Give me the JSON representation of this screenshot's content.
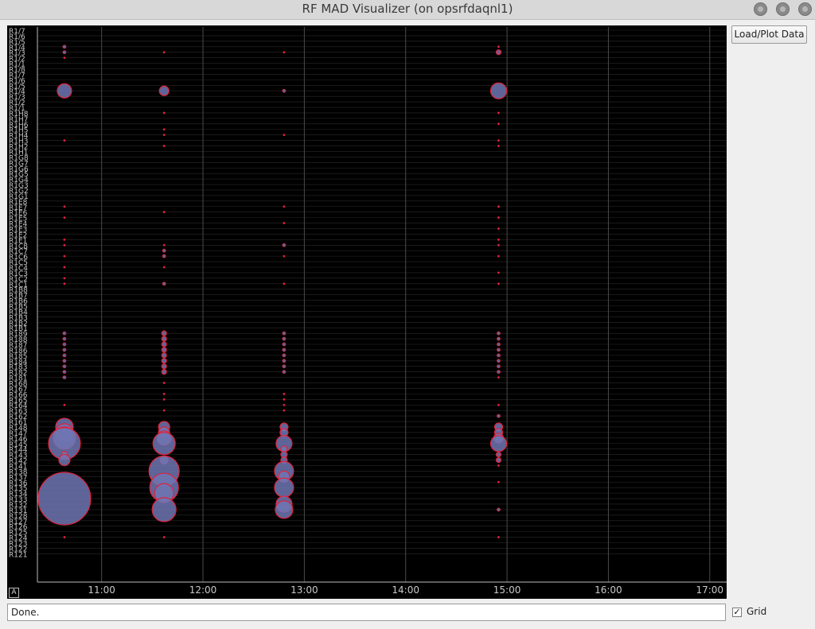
{
  "window": {
    "title": "RF MAD Visualizer (on opsrfdaqnl1)"
  },
  "buttons": {
    "load_plot": "Load/Plot Data"
  },
  "status": {
    "text": "Done."
  },
  "grid_checkbox": {
    "label": "Grid",
    "checked": true,
    "mark": "✓"
  },
  "plot": {
    "axis_badge": "A",
    "colors": {
      "background": "#000000",
      "bubble_fill": "#6f76b3",
      "bubble_stroke": "#e0233b",
      "label": "#c8c8c8"
    },
    "x_ticks": [
      "11:00",
      "12:00",
      "13:00",
      "14:00",
      "15:00",
      "16:00",
      "17:00"
    ],
    "y_labels": [
      "R1/7",
      "R1/6",
      "R1/5",
      "R1/4",
      "R1/3",
      "R1/2",
      "R1/1",
      "R1/8",
      "R1/7",
      "R1/6",
      "R1/5",
      "R1/4",
      "R1/3",
      "R1/2",
      "R1/1",
      "R1H8",
      "R1H7",
      "R1H6",
      "R1H5",
      "R1H4",
      "R1H3",
      "R1H2",
      "R1H1",
      "R1G8",
      "R1G7",
      "R1G6",
      "R1G5",
      "R1G4",
      "R1G3",
      "R1G2",
      "R1G1",
      "R1E8",
      "R1E7",
      "R1E6",
      "R1E5",
      "R1E4",
      "R1E3",
      "R1E2",
      "R1E1",
      "R1C8",
      "R1C7",
      "R1C6",
      "R1C5",
      "R1C4",
      "R1C3",
      "R1C2",
      "R1C1",
      "R1B8",
      "R1B7",
      "R1B6",
      "R1B5",
      "R1B4",
      "R1B3",
      "R1B2",
      "R1B1",
      "R189",
      "R188",
      "R187",
      "R186",
      "R185",
      "R184",
      "R183",
      "R182",
      "R181",
      "R168",
      "R167",
      "R166",
      "R165",
      "R164",
      "R163",
      "R162",
      "R161",
      "R148",
      "R147",
      "R146",
      "R145",
      "R144",
      "R143",
      "R142",
      "R141",
      "R138",
      "R137",
      "R136",
      "R135",
      "R134",
      "R133",
      "R132",
      "R131",
      "R128",
      "R127",
      "R126",
      "R125",
      "R124",
      "R123",
      "R122",
      "R121"
    ]
  },
  "chart_data": {
    "type": "scatter",
    "xlabel": "",
    "ylabel": "",
    "xlim": [
      "10:22",
      "17:10"
    ],
    "grid": true,
    "series": [
      {
        "time": "10:38",
        "points": [
          {
            "label": "R1/3",
            "size": 2
          },
          {
            "label": "R1/4",
            "size": 2
          },
          {
            "label": "R1/2",
            "size": 1
          },
          {
            "label": "R1/4",
            "size": 9,
            "index": 11
          },
          {
            "label": "R1H3",
            "size": 1,
            "index": 20
          },
          {
            "label": "R1E7",
            "size": 1,
            "index": 32
          },
          {
            "label": "R1E5",
            "size": 1,
            "index": 34
          },
          {
            "label": "R1E1",
            "size": 1,
            "index": 38
          },
          {
            "label": "R1C8",
            "size": 1,
            "index": 39
          },
          {
            "label": "R1C6",
            "size": 1,
            "index": 41
          },
          {
            "label": "R1C4",
            "size": 1,
            "index": 43
          },
          {
            "label": "R1C2",
            "size": 1,
            "index": 45
          },
          {
            "label": "R1C1",
            "size": 1,
            "index": 46
          },
          {
            "label": "R189",
            "size": 2,
            "index": 55
          },
          {
            "label": "R188",
            "size": 2,
            "index": 56
          },
          {
            "label": "R187",
            "size": 2,
            "index": 57
          },
          {
            "label": "R186",
            "size": 2,
            "index": 58
          },
          {
            "label": "R185",
            "size": 2,
            "index": 59
          },
          {
            "label": "R184",
            "size": 2,
            "index": 60
          },
          {
            "label": "R183",
            "size": 2,
            "index": 61
          },
          {
            "label": "R182",
            "size": 2,
            "index": 62
          },
          {
            "label": "R181",
            "size": 2,
            "index": 63
          },
          {
            "label": "R164",
            "size": 1,
            "index": 68
          },
          {
            "label": "R148",
            "size": 11,
            "index": 72
          },
          {
            "label": "R147",
            "size": 11,
            "index": 73
          },
          {
            "label": "R146",
            "size": 14,
            "index": 74
          },
          {
            "label": "R145",
            "size": 20,
            "index": 75
          },
          {
            "label": "R143",
            "size": 4,
            "index": 77
          },
          {
            "label": "R142",
            "size": 7,
            "index": 78
          },
          {
            "label": "R133",
            "size": 33,
            "index": 85
          },
          {
            "label": "R123",
            "size": 1,
            "index": 92
          }
        ]
      },
      {
        "time": "11:37",
        "points": [
          {
            "label": "R1/3",
            "size": 1,
            "index": 4
          },
          {
            "label": "R1/4",
            "size": 6,
            "index": 11
          },
          {
            "label": "R1H8",
            "size": 1,
            "index": 15
          },
          {
            "label": "R1H5",
            "size": 1,
            "index": 18
          },
          {
            "label": "R1H4",
            "size": 1,
            "index": 19
          },
          {
            "label": "R1H2",
            "size": 1,
            "index": 21
          },
          {
            "label": "R1E6",
            "size": 1,
            "index": 33
          },
          {
            "label": "R1C8",
            "size": 1,
            "index": 39
          },
          {
            "label": "R1C7",
            "size": 2,
            "index": 40
          },
          {
            "label": "R1C6",
            "size": 2,
            "index": 41
          },
          {
            "label": "R1C4",
            "size": 1,
            "index": 43
          },
          {
            "label": "R1C1",
            "size": 2,
            "index": 46
          },
          {
            "label": "R189",
            "size": 3,
            "index": 55
          },
          {
            "label": "R188",
            "size": 3,
            "index": 56
          },
          {
            "label": "R187",
            "size": 3,
            "index": 57
          },
          {
            "label": "R186",
            "size": 3,
            "index": 58
          },
          {
            "label": "R185",
            "size": 3,
            "index": 59
          },
          {
            "label": "R184",
            "size": 3,
            "index": 60
          },
          {
            "label": "R183",
            "size": 3,
            "index": 61
          },
          {
            "label": "R182",
            "size": 3,
            "index": 62
          },
          {
            "label": "R181",
            "size": 1,
            "index": 64
          },
          {
            "label": "R166",
            "size": 1,
            "index": 66
          },
          {
            "label": "R165",
            "size": 1,
            "index": 67
          },
          {
            "label": "R163",
            "size": 1,
            "index": 69
          },
          {
            "label": "R148",
            "size": 7,
            "index": 72
          },
          {
            "label": "R147",
            "size": 7,
            "index": 73
          },
          {
            "label": "R146",
            "size": 9,
            "index": 74
          },
          {
            "label": "R145",
            "size": 14,
            "index": 75
          },
          {
            "label": "R141",
            "size": 5,
            "index": 78
          },
          {
            "label": "R138",
            "size": 19,
            "index": 80
          },
          {
            "label": "R136",
            "size": 18,
            "index": 83
          },
          {
            "label": "R135",
            "size": 12,
            "index": 84
          },
          {
            "label": "R131",
            "size": 15,
            "index": 87
          },
          {
            "label": "R123",
            "size": 1,
            "index": 92
          }
        ]
      },
      {
        "time": "12:48",
        "points": [
          {
            "label": "R1/3",
            "size": 1,
            "index": 4
          },
          {
            "label": "R1/4",
            "size": 2,
            "index": 11
          },
          {
            "label": "R1H4",
            "size": 1,
            "index": 19
          },
          {
            "label": "R1E7",
            "size": 1,
            "index": 32
          },
          {
            "label": "R1E4",
            "size": 1,
            "index": 35
          },
          {
            "label": "R1C8",
            "size": 2,
            "index": 39
          },
          {
            "label": "R1C6",
            "size": 1,
            "index": 41
          },
          {
            "label": "R1C1",
            "size": 1,
            "index": 46
          },
          {
            "label": "R189",
            "size": 2,
            "index": 55
          },
          {
            "label": "R188",
            "size": 2,
            "index": 56
          },
          {
            "label": "R187",
            "size": 2,
            "index": 57
          },
          {
            "label": "R186",
            "size": 2,
            "index": 58
          },
          {
            "label": "R185",
            "size": 2,
            "index": 59
          },
          {
            "label": "R184",
            "size": 2,
            "index": 60
          },
          {
            "label": "R183",
            "size": 2,
            "index": 61
          },
          {
            "label": "R182",
            "size": 2,
            "index": 62
          },
          {
            "label": "R166",
            "size": 1,
            "index": 66
          },
          {
            "label": "R165",
            "size": 1,
            "index": 67
          },
          {
            "label": "R164",
            "size": 1,
            "index": 68
          },
          {
            "label": "R163",
            "size": 1,
            "index": 69
          },
          {
            "label": "R148",
            "size": 5,
            "index": 72
          },
          {
            "label": "R147",
            "size": 5,
            "index": 73
          },
          {
            "label": "R145",
            "size": 10,
            "index": 75
          },
          {
            "label": "R144",
            "size": 4,
            "index": 76
          },
          {
            "label": "R143",
            "size": 4,
            "index": 77
          },
          {
            "label": "R142",
            "size": 4,
            "index": 78
          },
          {
            "label": "R138",
            "size": 12,
            "index": 80
          },
          {
            "label": "R137",
            "size": 7,
            "index": 81
          },
          {
            "label": "R136",
            "size": 12,
            "index": 83
          },
          {
            "label": "R132",
            "size": 10,
            "index": 86
          },
          {
            "label": "R131",
            "size": 11,
            "index": 87
          }
        ]
      },
      {
        "time": "14:55",
        "points": [
          {
            "label": "R1/4",
            "size": 1,
            "index": 3
          },
          {
            "label": "R1/3",
            "size": 3,
            "index": 4
          },
          {
            "label": "R1/4",
            "size": 10,
            "index": 11
          },
          {
            "label": "R1H8",
            "size": 1,
            "index": 15
          },
          {
            "label": "R1H6",
            "size": 1,
            "index": 17
          },
          {
            "label": "R1H3",
            "size": 1,
            "index": 20
          },
          {
            "label": "R1H2",
            "size": 1,
            "index": 21
          },
          {
            "label": "R1E7",
            "size": 1,
            "index": 32
          },
          {
            "label": "R1E5",
            "size": 1,
            "index": 34
          },
          {
            "label": "R1E3",
            "size": 1,
            "index": 36
          },
          {
            "label": "R1E1",
            "size": 1,
            "index": 38
          },
          {
            "label": "R1C8",
            "size": 1,
            "index": 39
          },
          {
            "label": "R1C6",
            "size": 1,
            "index": 41
          },
          {
            "label": "R1C3",
            "size": 1,
            "index": 44
          },
          {
            "label": "R1C1",
            "size": 1,
            "index": 46
          },
          {
            "label": "R189",
            "size": 2,
            "index": 55
          },
          {
            "label": "R188",
            "size": 2,
            "index": 56
          },
          {
            "label": "R187",
            "size": 2,
            "index": 57
          },
          {
            "label": "R186",
            "size": 2,
            "index": 58
          },
          {
            "label": "R185",
            "size": 2,
            "index": 59
          },
          {
            "label": "R184",
            "size": 2,
            "index": 60
          },
          {
            "label": "R183",
            "size": 2,
            "index": 61
          },
          {
            "label": "R182",
            "size": 2,
            "index": 62
          },
          {
            "label": "R181",
            "size": 1,
            "index": 63
          },
          {
            "label": "R164",
            "size": 1,
            "index": 68
          },
          {
            "label": "R162",
            "size": 2,
            "index": 70
          },
          {
            "label": "R148",
            "size": 5,
            "index": 72
          },
          {
            "label": "R147",
            "size": 5,
            "index": 73
          },
          {
            "label": "R146",
            "size": 6,
            "index": 74
          },
          {
            "label": "R145",
            "size": 10,
            "index": 75
          },
          {
            "label": "R143",
            "size": 3,
            "index": 77
          },
          {
            "label": "R142",
            "size": 3,
            "index": 78
          },
          {
            "label": "R141",
            "size": 1,
            "index": 79
          },
          {
            "label": "R136",
            "size": 1,
            "index": 82
          },
          {
            "label": "R131",
            "size": 2,
            "index": 87
          },
          {
            "label": "R123",
            "size": 1,
            "index": 92
          }
        ]
      }
    ]
  }
}
